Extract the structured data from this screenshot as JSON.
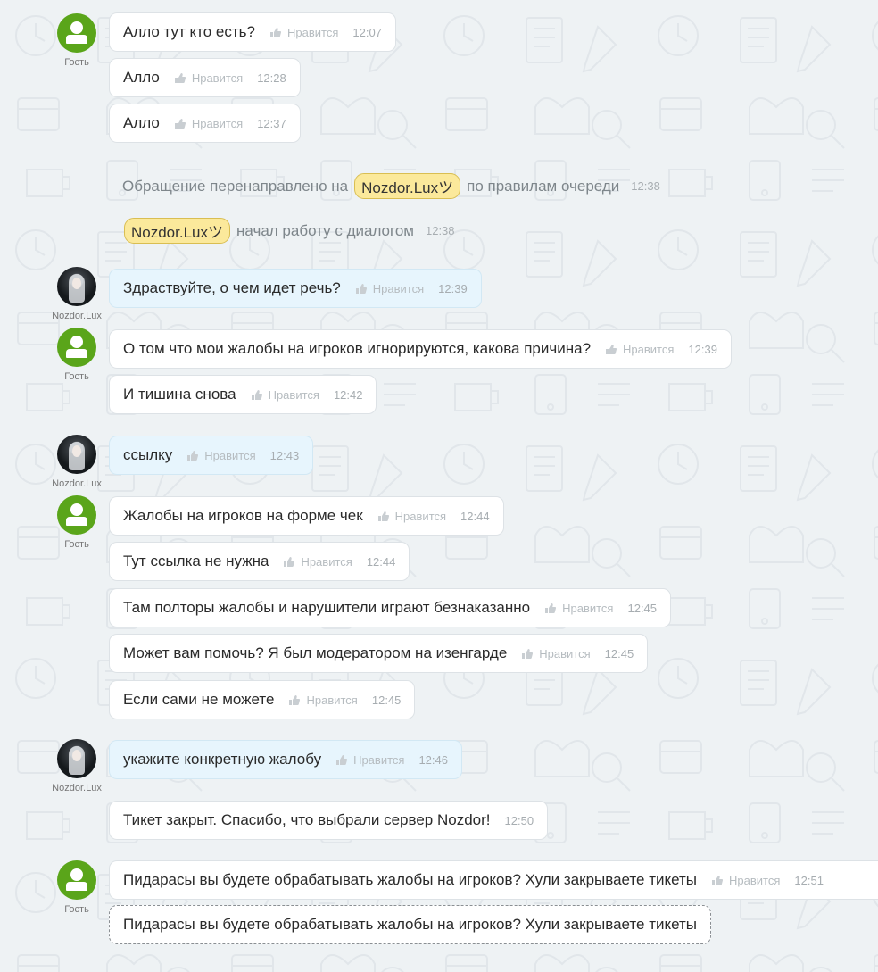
{
  "names": {
    "guest": "Гость",
    "operator": "Nozdor.Lux"
  },
  "like_label": "Нравится",
  "system": {
    "redirect_prefix": "Обращение перенаправлено на",
    "redirect_operator": "Nozdor.Luxツ",
    "redirect_suffix": "по правилам очереди",
    "redirect_time": "12:38",
    "start_operator": "Nozdor.Luxツ",
    "start_suffix": "начал работу с диалогом",
    "start_time": "12:38"
  },
  "messages": [
    {
      "text": "Алло тут кто есть?",
      "time": "12:07"
    },
    {
      "text": "Алло",
      "time": "12:28"
    },
    {
      "text": "Алло",
      "time": "12:37"
    },
    {
      "text": "Здраствуйте, о чем идет речь?",
      "time": "12:39"
    },
    {
      "text": "О том что мои жалобы на игроков игнорируются, какова причина?",
      "time": "12:39"
    },
    {
      "text": "И тишина снова",
      "time": "12:42"
    },
    {
      "text": "ссылку",
      "time": "12:43"
    },
    {
      "text": "Жалобы на игроков на форме чек",
      "time": "12:44"
    },
    {
      "text": "Тут ссылка не нужна",
      "time": "12:44"
    },
    {
      "text": "Там полторы жалобы и нарушители играют безнаказанно",
      "time": "12:45"
    },
    {
      "text": "Может вам помочь? Я был модератором на изенгарде",
      "time": "12:45"
    },
    {
      "text": "Если сами не можете",
      "time": "12:45"
    },
    {
      "text": "укажите конкретную жалобу",
      "time": "12:46"
    },
    {
      "text": "Тикет закрыт. Спасибо, что выбрали сервер Nozdor!",
      "time": "12:50"
    },
    {
      "text": "Пидарасы вы будете обрабатывать жалобы на игроков? Хули закрываете тикеты",
      "time": "12:51"
    }
  ],
  "draft": {
    "text": "Пидарасы вы будете обрабатывать жалобы на игроков? Хули закрываете тикеты"
  }
}
